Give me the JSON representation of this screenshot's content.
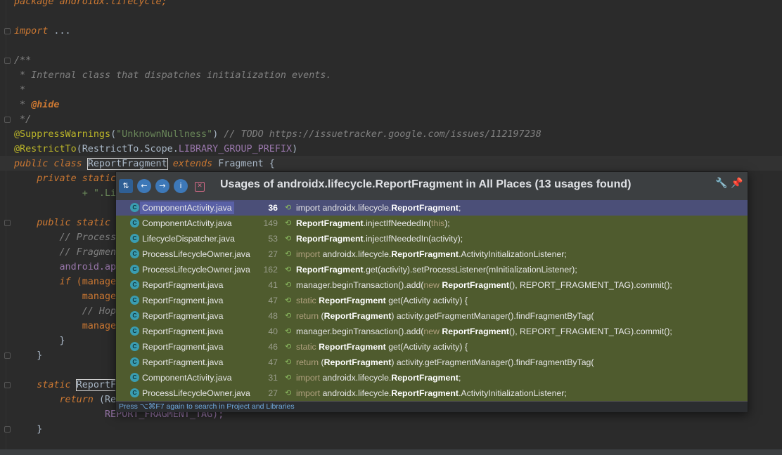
{
  "editor": {
    "lines": {
      "l1": "package androidx.lifecycle;",
      "l2_kw": "import",
      "l2_rest": " ...",
      "l3": "/**",
      "l4": " * Internal class that dispatches initialization events.",
      "l5": " *",
      "l6_pre": " * ",
      "l6_tag": "@hide",
      "l7": " */",
      "l8_ann": "@SuppressWarnings",
      "l8_p1": "(",
      "l8_str": "\"UnknownNullness\"",
      "l8_p2": ") ",
      "l8_cm": "// TODO https://issuetracker.google.com/issues/112197238",
      "l9_ann": "@RestrictTo",
      "l9_p1": "(RestrictTo.Scope.",
      "l9_fld": "LIBRARY_GROUP_PREFIX",
      "l9_p2": ")",
      "l10_kw1": "public class ",
      "l10_cls": "ReportFragment",
      "l10_kw2": " extends ",
      "l10_sup": "Fragment",
      "l10_end": " {",
      "l11_kw": "    private static",
      "l12": "            + \".Li",
      "l13_kw": "    public static",
      "l14": "        // Process",
      "l15": "        // Fragmen",
      "l16": "        android.ap",
      "l17_kw": "        if",
      "l17_rest": " (manage",
      "l18": "            manage",
      "l19": "            // Hop",
      "l20": "            manage",
      "l21": "        }",
      "l22": "    }",
      "l23_kw": "    static",
      "l23_rest": "ReportF",
      "l24_kw": "        return",
      "l24_rest": " (Re",
      "l25": "                REPORT_FRAGMENT_TAG);",
      "l26": "    }"
    }
  },
  "popup": {
    "title": "Usages of androidx.lifecycle.ReportFragment in All Places (13 usages found)",
    "toolbar": {
      "merge": "⇅",
      "prev": "←",
      "next": "→",
      "info": "i",
      "close": "✕"
    },
    "settings_icon": "🔧",
    "pin_icon": "📌",
    "hint": "Press ⌥⌘F7 again to search in Project and Libraries",
    "usages": [
      {
        "file": "ComponentActivity.java",
        "line": "36",
        "parts": [
          [
            "import androidx.lifecycle.",
            ""
          ],
          [
            "ReportFragment",
            "b"
          ],
          [
            ";",
            ""
          ]
        ]
      },
      {
        "file": "ComponentActivity.java",
        "line": "149",
        "parts": [
          [
            "ReportFragment",
            "b"
          ],
          [
            ".injectIfNeededIn(",
            ""
          ],
          [
            "this",
            "k"
          ],
          [
            ");",
            ""
          ]
        ]
      },
      {
        "file": "LifecycleDispatcher.java",
        "line": "53",
        "parts": [
          [
            "ReportFragment",
            "b"
          ],
          [
            ".injectIfNeededIn(activity);",
            ""
          ]
        ]
      },
      {
        "file": "ProcessLifecycleOwner.java",
        "line": "27",
        "parts": [
          [
            "import",
            "k"
          ],
          [
            " androidx.lifecycle.",
            ""
          ],
          [
            "ReportFragment",
            "b"
          ],
          [
            ".ActivityInitializationListener;",
            ""
          ]
        ]
      },
      {
        "file": "ProcessLifecycleOwner.java",
        "line": "162",
        "parts": [
          [
            "ReportFragment",
            "b"
          ],
          [
            ".get(activity).setProcessListener(mInitializationListener);",
            ""
          ]
        ]
      },
      {
        "file": "ReportFragment.java",
        "line": "41",
        "parts": [
          [
            "manager.beginTransaction().add(",
            ""
          ],
          [
            "new ",
            "k"
          ],
          [
            "ReportFragment",
            "b"
          ],
          [
            "(), REPORT_FRAGMENT_TAG).commit();",
            ""
          ]
        ]
      },
      {
        "file": "ReportFragment.java",
        "line": "47",
        "parts": [
          [
            "static ",
            "k"
          ],
          [
            "ReportFragment",
            "b"
          ],
          [
            " get(Activity activity) {",
            ""
          ]
        ]
      },
      {
        "file": "ReportFragment.java",
        "line": "48",
        "parts": [
          [
            "return ",
            "k"
          ],
          [
            "(",
            ""
          ],
          [
            "ReportFragment",
            "b"
          ],
          [
            ") activity.getFragmentManager().findFragmentByTag(",
            ""
          ]
        ]
      },
      {
        "file": "ReportFragment.java",
        "line": "40",
        "parts": [
          [
            "manager.beginTransaction().add(",
            ""
          ],
          [
            "new ",
            "k"
          ],
          [
            "ReportFragment",
            "b"
          ],
          [
            "(), REPORT_FRAGMENT_TAG).commit();",
            ""
          ]
        ]
      },
      {
        "file": "ReportFragment.java",
        "line": "46",
        "parts": [
          [
            "static ",
            "k"
          ],
          [
            "ReportFragment",
            "b"
          ],
          [
            " get(Activity activity) {",
            ""
          ]
        ]
      },
      {
        "file": "ReportFragment.java",
        "line": "47",
        "parts": [
          [
            "return ",
            "k"
          ],
          [
            "(",
            ""
          ],
          [
            "ReportFragment",
            "b"
          ],
          [
            ") activity.getFragmentManager().findFragmentByTag(",
            ""
          ]
        ]
      },
      {
        "file": "ComponentActivity.java",
        "line": "31",
        "parts": [
          [
            "import",
            "k"
          ],
          [
            " androidx.lifecycle.",
            ""
          ],
          [
            "ReportFragment",
            "b"
          ],
          [
            ";",
            ""
          ]
        ]
      },
      {
        "file": "ProcessLifecycleOwner.java",
        "line": "27",
        "parts": [
          [
            "import",
            "k"
          ],
          [
            " androidx.lifecycle.",
            ""
          ],
          [
            "ReportFragment",
            "b"
          ],
          [
            ".ActivityInitializationListener;",
            ""
          ]
        ]
      }
    ],
    "file_icon_letter": "C",
    "usage_arrow": "⟲"
  },
  "colors": {
    "editor_bg": "#2b2b2b",
    "keyword": "#cc7832",
    "comment": "#808080",
    "annotation": "#bbb529",
    "string": "#6a8759",
    "popup_rows_bg": "#4f5b2e",
    "selected_row_bg": "#4b4f78",
    "hint_text": "#6fa8dc"
  }
}
